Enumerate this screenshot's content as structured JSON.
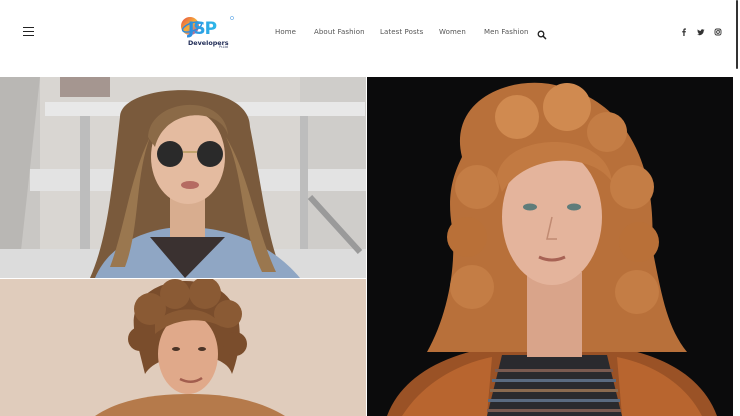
{
  "header": {
    "logo": {
      "brand": "JSP",
      "name": "Developers",
      "tagline": "Pr.Ltd"
    },
    "nav": [
      {
        "label": "Home"
      },
      {
        "label": "About Fashion"
      },
      {
        "label": "Latest Posts"
      },
      {
        "label": "Women"
      },
      {
        "label": "Men Fashion"
      }
    ],
    "icons": {
      "menu": "menu-icon",
      "search": "search-icon",
      "social": [
        "facebook-icon",
        "twitter-icon",
        "instagram-icon"
      ]
    }
  },
  "gallery": {
    "photos": [
      {
        "subject": "woman-sunglasses-denim-jacket"
      },
      {
        "subject": "man-curly-hair"
      },
      {
        "subject": "woman-red-curly-hair"
      }
    ]
  },
  "colors": {
    "accent": "#1e2a55",
    "nav_text": "#555555",
    "background": "#ffffff",
    "dark_photo_bg": "#0b0b0c"
  }
}
